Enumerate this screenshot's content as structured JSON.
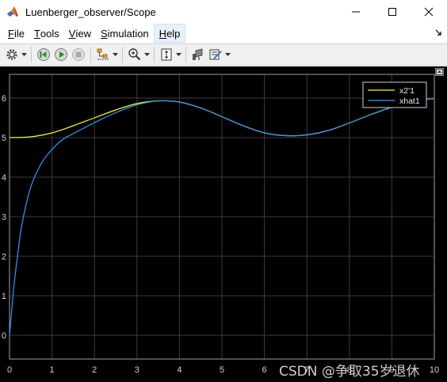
{
  "window": {
    "title": "Luenberger_observer/Scope",
    "app_icon": "matlab-icon",
    "controls": [
      "minimize-icon",
      "maximize-icon",
      "close-icon"
    ]
  },
  "menu": {
    "items": [
      {
        "label": "File",
        "u": "F",
        "rest": "ile"
      },
      {
        "label": "Tools",
        "u": "T",
        "rest": "ools"
      },
      {
        "label": "View",
        "u": "V",
        "rest": "iew"
      },
      {
        "label": "Simulation",
        "u": "S",
        "rest": "imulation"
      },
      {
        "label": "Help",
        "u": "H",
        "rest": "elp"
      }
    ]
  },
  "toolbar": {
    "icons": [
      "gear-icon",
      "step-back-icon",
      "run-icon",
      "stop-icon",
      "signal-select-icon",
      "zoom-in-icon",
      "autoscale-icon",
      "highlight-icon",
      "style-icon"
    ]
  },
  "colors": {
    "x2": "#ffff00",
    "xhat": "#2b9cff",
    "grid": "#3c3c3c",
    "axes": "#a0a0a0",
    "background": "#000000"
  },
  "watermark": "CSDN @争取35岁退休",
  "chart_data": {
    "type": "line",
    "xlim": [
      0,
      10
    ],
    "ylim": [
      -0.6,
      6.6
    ],
    "x_ticks": [
      0,
      1,
      2,
      3,
      4,
      5,
      6,
      7,
      8,
      9,
      10
    ],
    "y_ticks": [
      0,
      1,
      2,
      3,
      4,
      5,
      6
    ],
    "grid": true,
    "legend_position": "top-right",
    "series": [
      {
        "name": "x2'1",
        "color": "#ffff00",
        "x": [
          0,
          0.5,
          1,
          1.5,
          2,
          2.5,
          3,
          3.5,
          4,
          4.5,
          5,
          5.5,
          6,
          6.5,
          7,
          7.5,
          8,
          8.5,
          9,
          9.5,
          10
        ],
        "y": [
          5.0,
          5.02,
          5.12,
          5.3,
          5.5,
          5.7,
          5.86,
          5.93,
          5.9,
          5.75,
          5.53,
          5.3,
          5.12,
          5.05,
          5.07,
          5.18,
          5.37,
          5.58,
          5.77,
          5.92,
          5.99
        ]
      },
      {
        "name": "xhat1",
        "color": "#2b9cff",
        "x": [
          0,
          0.1,
          0.2,
          0.3,
          0.5,
          0.75,
          1,
          1.25,
          1.5,
          2,
          2.5,
          3,
          3.5,
          4,
          4.5,
          5,
          5.5,
          6,
          6.5,
          7,
          7.5,
          8,
          8.5,
          9,
          9.5,
          10
        ],
        "y": [
          0.0,
          1.2,
          2.1,
          2.85,
          3.75,
          4.35,
          4.7,
          4.95,
          5.1,
          5.38,
          5.63,
          5.83,
          5.93,
          5.9,
          5.75,
          5.53,
          5.3,
          5.12,
          5.05,
          5.07,
          5.18,
          5.37,
          5.58,
          5.77,
          5.92,
          5.99
        ]
      }
    ]
  }
}
